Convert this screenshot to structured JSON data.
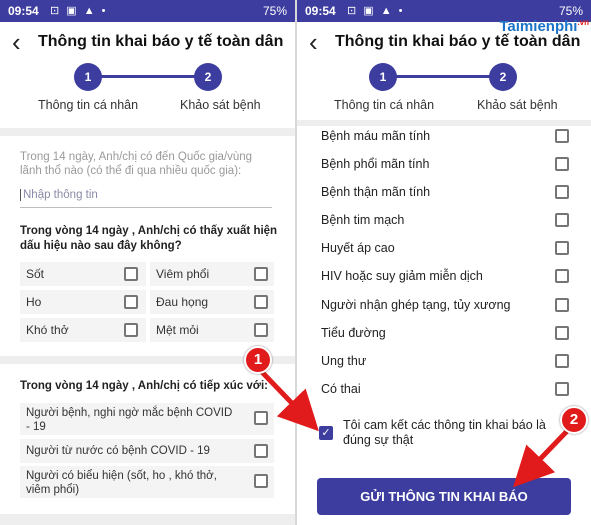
{
  "statusbar": {
    "time": "09:54",
    "battery": "75%",
    "left_icons": "⊡ ▣ ▲ •",
    "signal": "⚡ ◢"
  },
  "appbar": {
    "title": "Thông tin khai báo y tế toàn dân"
  },
  "stepper": {
    "step1": "1",
    "step2": "2",
    "label1": "Thông tin cá nhân",
    "label2": "Khảo sát bệnh"
  },
  "left": {
    "country_hint": "Trong 14 ngày, Anh/chị có đến Quốc gia/vùng lãnh thổ nào (có thể đi qua nhiều quốc gia):",
    "country_placeholder": "Nhập thông tin",
    "symptoms_question": "Trong vòng 14 ngày , Anh/chị có thấy xuất hiện dấu hiệu nào sau đây không?",
    "symptoms": [
      "Sốt",
      "Viêm phổi",
      "Ho",
      "Đau họng",
      "Khó thở",
      "Mệt mỏi"
    ],
    "contact_question": "Trong vòng 14 ngày , Anh/chị có tiếp xúc với:",
    "contacts": [
      "Người bệnh, nghi ngờ mắc bệnh COVID - 19",
      "Người từ nước có bệnh COVID - 19",
      "Người có biểu hiện (sốt, ho , khó thở, viêm phổi)"
    ]
  },
  "right": {
    "conditions": [
      "Bệnh máu mãn tính",
      "Bệnh phổi mãn tính",
      "Bệnh thận mãn tính",
      "Bệnh tim mạch",
      "Huyết áp cao",
      "HIV hoặc suy giảm miễn dịch",
      "Người nhận ghép tạng, tủy xương",
      "Tiểu đường",
      "Ung thư",
      "Có thai"
    ],
    "commitment": "Tôi cam kết các thông tin khai báo là đúng sự thật",
    "submit": "GỬI THÔNG TIN KHAI BÁO"
  },
  "annotations": {
    "badge1": "1",
    "badge2": "2"
  },
  "watermark": {
    "brand": "Taimienphi",
    "domain": ".vn"
  },
  "colors": {
    "primary": "#3d3da0",
    "badge": "#e11b1b",
    "row_bg": "#f4f4f4"
  }
}
